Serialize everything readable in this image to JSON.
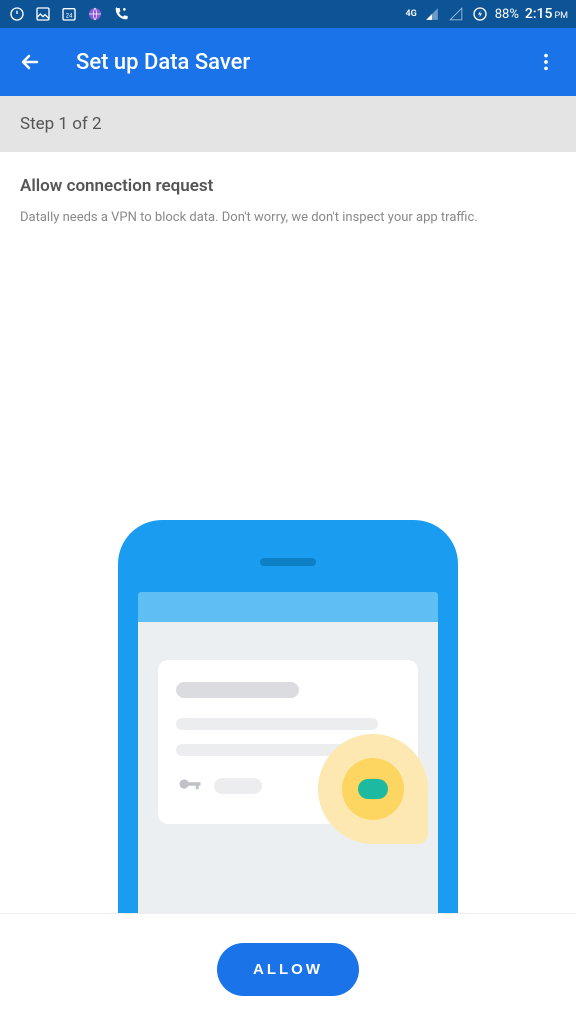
{
  "status": {
    "network": "4G",
    "battery": "88%",
    "time": "2:15",
    "ampm": "PM"
  },
  "appbar": {
    "title": "Set up Data Saver"
  },
  "step": {
    "label": "Step 1 of 2"
  },
  "content": {
    "heading": "Allow connection request",
    "desc": "Datally needs a VPN to block data. Don't worry, we don't inspect your app traffic."
  },
  "action": {
    "allow": "ALLOW"
  }
}
